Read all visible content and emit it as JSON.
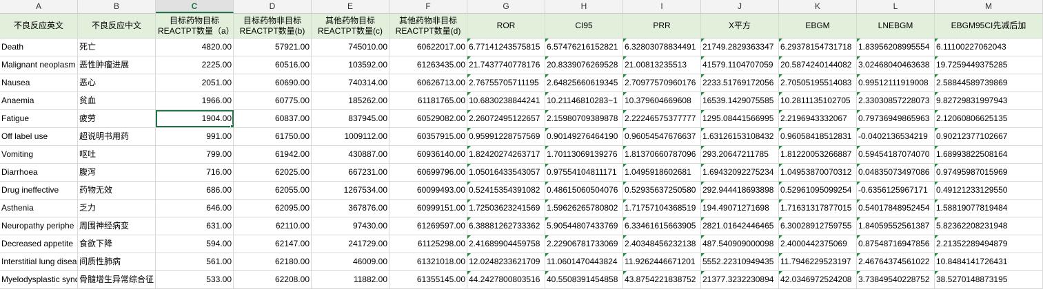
{
  "column_letters": [
    "A",
    "B",
    "C",
    "D",
    "E",
    "F",
    "G",
    "H",
    "I",
    "J",
    "K",
    "L",
    "M"
  ],
  "selected_column": "C",
  "headers": [
    "不良反应英文",
    "不良反应中文",
    "目标药物目标REACTPT数量（a）",
    "目标药物非目标REACTPT数量(b)",
    "其他药物目标REACTPT数量(c)",
    "其他药物非目标REACTPT数量(d)",
    "ROR",
    "CI95",
    "PRR",
    "X平方",
    "EBGM",
    "LNEBGM",
    "EBGM95CI先减后加"
  ],
  "active_cell": {
    "row": 4,
    "col": 2
  },
  "rows": [
    [
      "Death",
      "死亡",
      "4820.00",
      "57921.00",
      "745010.00",
      "60622017.00",
      "6.77141243575815",
      "6.57476216152821",
      "6.32803078834491",
      "21749.2829363347",
      "6.29378154731718",
      "1.83956208995554",
      "6.11100227062043"
    ],
    [
      "Malignant neoplasm",
      "恶性肿瘤进展",
      "2225.00",
      "60516.00",
      "103592.00",
      "61263435.00",
      "21.7437740778176",
      "20.8339076269528",
      "21.00813235513",
      "41579.1104707059",
      "20.5874240144082",
      "3.02468040463638",
      "19.7259449375285"
    ],
    [
      "Nausea",
      "恶心",
      "2051.00",
      "60690.00",
      "740314.00",
      "60626713.00",
      "2.76755705711195",
      "2.64825660619345",
      "2.70977570960176",
      "2233.51769172056",
      "2.70505195514083",
      "0.99512111919008",
      "2.58844589739869"
    ],
    [
      "Anaemia",
      "贫血",
      "1966.00",
      "60775.00",
      "185262.00",
      "61181765.00",
      "10.6830238844241",
      "10.21146810283~1",
      "10.379604669608",
      "16539.1429075585",
      "10.2811135102705",
      "2.33030857228073",
      "9.82729831997943"
    ],
    [
      "Fatigue",
      "疲劳",
      "1904.00",
      "60837.00",
      "837945.00",
      "60529082.00",
      "2.26072495122657",
      "2.15980709389878",
      "2.22246575377777",
      "1295.08441566995",
      "2.2196943332067",
      "0.79736949865963",
      "2.12060806625135"
    ],
    [
      "Off label use",
      "超说明书用药",
      "991.00",
      "61750.00",
      "1009112.00",
      "60357915.00",
      "0.95991228757569",
      "0.90149276464190",
      "0.96054547676637",
      "1.63126153108432",
      "0.96058418512831",
      "-0.0402136534219",
      "0.90212377102667"
    ],
    [
      "Vomiting",
      "呕吐",
      "799.00",
      "61942.00",
      "430887.00",
      "60936140.00",
      "1.82420274263717",
      "1.70113069139276",
      "1.81370660787096",
      "293.20647211785",
      "1.81220053266887",
      "0.59454187074070",
      "1.68993822508164"
    ],
    [
      "Diarrhoea",
      "腹泻",
      "716.00",
      "62025.00",
      "667231.00",
      "60699796.00",
      "1.05016433543057",
      "0.97554104811171",
      "1.0495918602681",
      "1.69432092275234",
      "1.04953870070312",
      "0.04835073497086",
      "0.97495987015969"
    ],
    [
      "Drug ineffective",
      "药物无效",
      "686.00",
      "62055.00",
      "1267534.00",
      "60099493.00",
      "0.52415354391082",
      "0.48615060504076",
      "0.52935637250580",
      "292.944418693898",
      "0.52961095099254",
      "-0.6356125967171",
      "0.49121233129550"
    ],
    [
      "Asthenia",
      "乏力",
      "646.00",
      "62095.00",
      "367876.00",
      "60999151.00",
      "1.72503623241569",
      "1.59626265780802",
      "1.71757104368519",
      "194.49071271698",
      "1.71631317877015",
      "0.54017848952454",
      "1.58819077819484"
    ],
    [
      "Neuropathy periphe",
      "周围神经病变",
      "631.00",
      "62110.00",
      "97430.00",
      "61269597.00",
      "6.38881262733362",
      "5.90544807433769",
      "6.33461615663905",
      "2821.01642446465",
      "6.30028912759755",
      "1.84059552561387",
      "5.82362208231948"
    ],
    [
      "Decreased appetite",
      "食欲下降",
      "594.00",
      "62147.00",
      "241729.00",
      "61125298.00",
      "2.41689904459758",
      "2.22906781733069",
      "2.40348456232138",
      "487.540909000098",
      "2.4000442375069",
      "0.87548716947856",
      "2.21352289494879"
    ],
    [
      "Interstitial lung disea",
      "间质性肺病",
      "561.00",
      "62180.00",
      "46009.00",
      "61321018.00",
      "12.0248233621709",
      "11.0601470443824",
      "11.9262446671201",
      "5552.22310949435",
      "11.7946229523197",
      "2.46764374561022",
      "10.8484141726431"
    ],
    [
      "Myelodysplastic synd",
      "骨髓增生异常综合征",
      "533.00",
      "62208.00",
      "11882.00",
      "61355145.00",
      "44.2427800803516",
      "40.5508391454858",
      "43.8754221838752",
      "21377.3232230894",
      "42.0346972524208",
      "3.73849540228752",
      "38.5270148873195"
    ]
  ]
}
